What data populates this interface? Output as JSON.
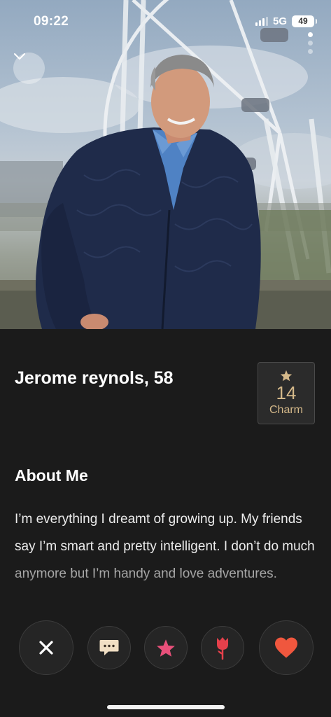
{
  "status_bar": {
    "time": "09:22",
    "network": "5G",
    "battery": "49"
  },
  "photo": {
    "alt": "Profile photo",
    "page_count": 3,
    "active_page": 1
  },
  "profile": {
    "name_age": "Jerome reynols, 58"
  },
  "charm": {
    "count": "14",
    "label": "Charm",
    "icon": "star-icon"
  },
  "about": {
    "title": "About Me",
    "text": "I’m everything I dreamt of growing up.  My friends say I’m smart and pretty intelligent. I don’t do much anymore but I’m handy and love adventures."
  },
  "actions": [
    {
      "name": "pass",
      "icon": "close-icon"
    },
    {
      "name": "message",
      "icon": "chat-bubble-icon"
    },
    {
      "name": "super-like",
      "icon": "star-icon"
    },
    {
      "name": "rose",
      "icon": "rose-icon"
    },
    {
      "name": "like",
      "icon": "heart-icon"
    }
  ],
  "colors": {
    "background": "#1b1b1b",
    "charm_gold": "#d5b98a",
    "super_like_pink": "#e8507a",
    "rose_red": "#e5404b",
    "like_orange": "#f0573e"
  }
}
